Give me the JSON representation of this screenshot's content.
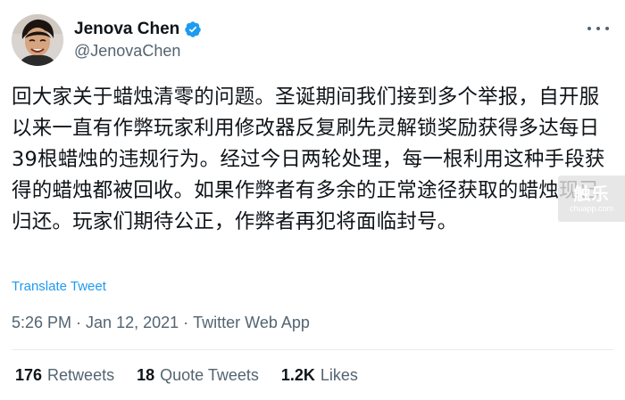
{
  "author": {
    "display_name": "Jenova Chen",
    "handle": "@JenovaChen",
    "verified": true,
    "avatar_icon": "profile-photo",
    "verified_color": "#1d9bf0"
  },
  "more_icon": "ellipsis-icon",
  "tweet": {
    "text": "回大家关于蜡烛清零的问题。圣诞期间我们接到多个举报，自开服以来一直有作弊玩家利用修改器反复刷先灵解锁奖励获得多达每日39根蜡烛的违规行为。经过今日两轮处理，每一根利用这种手段获得的蜡烛都被回收。如果作弊者有多余的正常途径获取的蜡烛现已归还。玩家们期待公正，作弊者再犯将面临封号。",
    "translate_label": "Translate Tweet"
  },
  "meta": {
    "time": "5:26 PM",
    "separator": " · ",
    "date": "Jan 12, 2021",
    "source": "Twitter Web App"
  },
  "stats": {
    "retweets_count": "176",
    "retweets_label": "Retweets",
    "quote_count": "18",
    "quote_label": "Quote Tweets",
    "likes_count": "1.2K",
    "likes_label": "Likes"
  },
  "watermark": {
    "main": "触乐",
    "sub": "chuapp.com"
  },
  "colors": {
    "text_primary": "#0f1419",
    "text_secondary": "#536471",
    "accent": "#1d9bf0"
  }
}
